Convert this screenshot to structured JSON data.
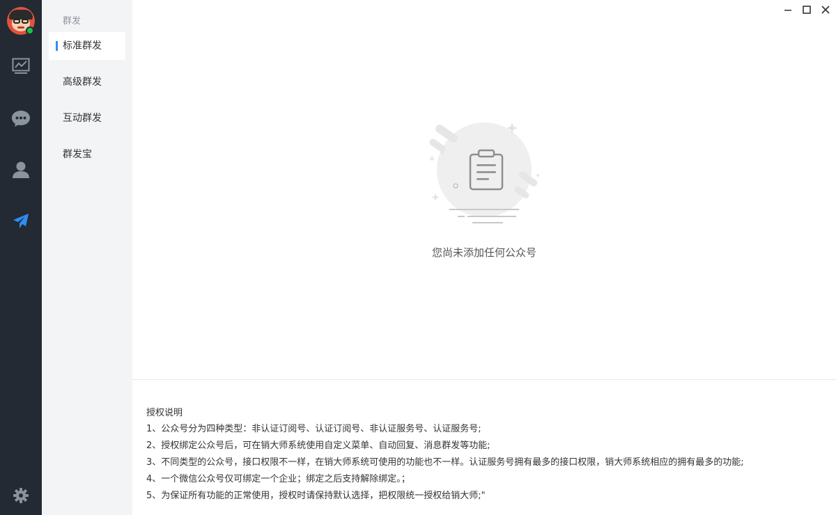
{
  "sidebar": {
    "section_title": "群发",
    "items": [
      {
        "label": "标准群发",
        "active": true
      },
      {
        "label": "高级群发",
        "active": false
      },
      {
        "label": "互动群发",
        "active": false
      },
      {
        "label": "群发宝",
        "active": false
      }
    ]
  },
  "rail": {
    "icons": [
      "avatar",
      "chart-icon",
      "chat-bubble-icon",
      "user-icon",
      "send-icon",
      "gear-icon"
    ],
    "active_color": "#2f8df4",
    "icon_color": "#8b939c"
  },
  "empty_state": {
    "message": "您尚未添加任何公众号",
    "icon": "clipboard-icon"
  },
  "auth_notes": {
    "title": "授权说明",
    "lines": [
      "1、公众号分为四种类型：非认证订阅号、认证订阅号、非认证服务号、认证服务号;",
      "2、授权绑定公众号后，可在销大师系统使用自定义菜单、自动回复、消息群发等功能;",
      "3、不同类型的公众号，接口权限不一样，在销大师系统可使用的功能也不一样。认证服务号拥有最多的接口权限，销大师系统相应的拥有最多的功能;",
      "4、一个微信公众号仅可绑定一个企业；绑定之后支持解除绑定。；",
      "5、为保证所有功能的正常使用，授权时请保持默认选择，把权限统一授权给销大师;\""
    ]
  },
  "colors": {
    "rail_bg": "#232a33",
    "subnav_bg": "#f3f4f6",
    "accent": "#2f8df4",
    "online": "#19c24b"
  }
}
